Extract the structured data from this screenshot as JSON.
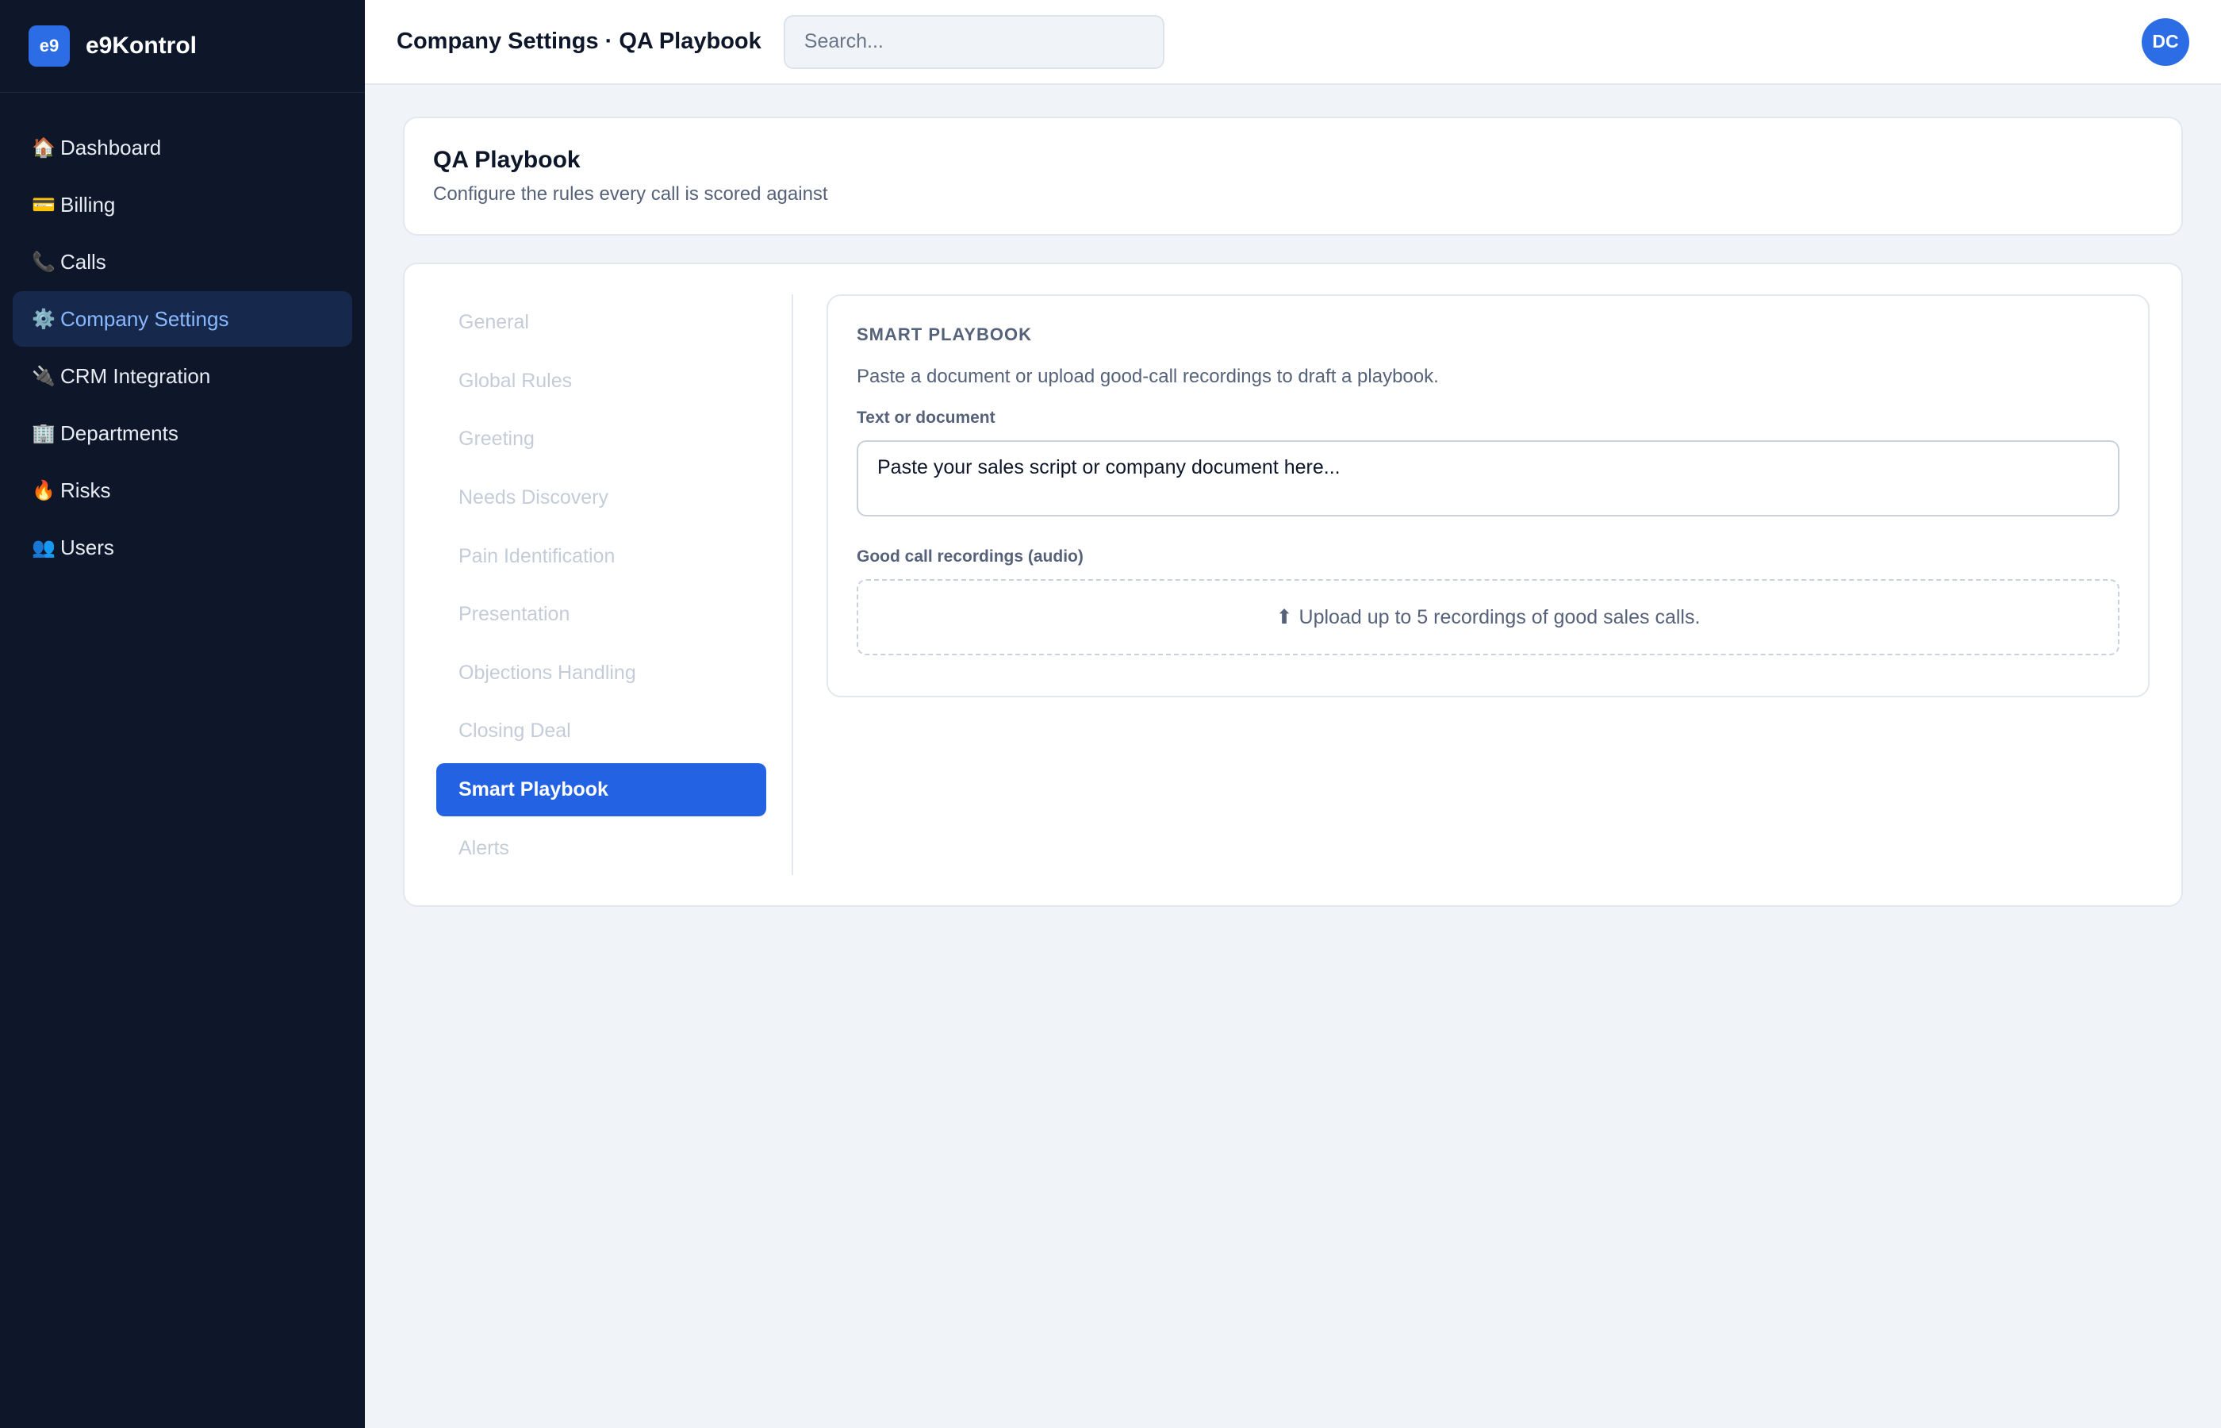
{
  "brand": {
    "logo": "e9",
    "name": "e9Kontrol"
  },
  "sidebar": {
    "items": [
      {
        "icon": "🏠",
        "icon_name": "house-icon",
        "label": "Dashboard"
      },
      {
        "icon": "💳",
        "icon_name": "credit-card-icon",
        "label": "Billing"
      },
      {
        "icon": "📞",
        "icon_name": "phone-icon",
        "label": "Calls"
      },
      {
        "icon": "⚙️",
        "icon_name": "gear-icon",
        "label": "Company Settings",
        "active": true
      },
      {
        "icon": "🔌",
        "icon_name": "plug-icon",
        "label": "CRM Integration"
      },
      {
        "icon": "🏢",
        "icon_name": "building-icon",
        "label": "Departments"
      },
      {
        "icon": "🔥",
        "icon_name": "fire-icon",
        "label": "Risks"
      },
      {
        "icon": "👥",
        "icon_name": "users-icon",
        "label": "Users"
      }
    ]
  },
  "header": {
    "title": "Company Settings · QA Playbook",
    "search_placeholder": "Search...",
    "avatar_initials": "DC"
  },
  "page": {
    "title": "QA Playbook",
    "subtitle": "Configure the rules every call is scored against"
  },
  "tabs": [
    {
      "label": "General"
    },
    {
      "label": "Global Rules"
    },
    {
      "label": "Greeting"
    },
    {
      "label": "Needs Discovery"
    },
    {
      "label": "Pain Identification"
    },
    {
      "label": "Presentation"
    },
    {
      "label": "Objections Handling"
    },
    {
      "label": "Closing Deal"
    },
    {
      "label": "Smart Playbook",
      "active": true
    },
    {
      "label": "Alerts"
    }
  ],
  "smart_playbook": {
    "title": "SMART PLAYBOOK",
    "description": "Paste a document or upload good-call recordings to draft a playbook.",
    "text_label": "Text or document",
    "text_placeholder": "Paste your sales script or company document here...",
    "recordings_label": "Good call recordings (audio)",
    "upload_icon": "⬆",
    "upload_text": "Upload up to 5 recordings of good sales calls."
  },
  "colors": {
    "sidebar_bg": "#0e1729",
    "accent": "#2462e4",
    "active_nav_text": "#8ab8ff",
    "page_bg": "#f0f4f9"
  }
}
